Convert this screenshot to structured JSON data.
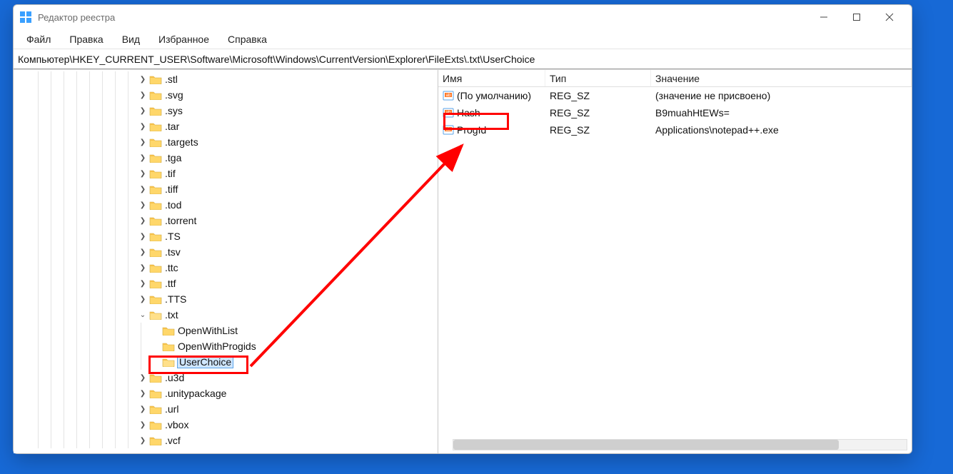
{
  "window": {
    "title": "Редактор реестра"
  },
  "menu": {
    "file": "Файл",
    "edit": "Правка",
    "view": "Вид",
    "favorites": "Избранное",
    "help": "Справка"
  },
  "addressbar": "Компьютер\\HKEY_CURRENT_USER\\Software\\Microsoft\\Windows\\CurrentVersion\\Explorer\\FileExts\\.txt\\UserChoice",
  "tree": [
    {
      "label": ".stl",
      "expander": ">",
      "depth": 8
    },
    {
      "label": ".svg",
      "expander": ">",
      "depth": 8
    },
    {
      "label": ".sys",
      "expander": ">",
      "depth": 8
    },
    {
      "label": ".tar",
      "expander": ">",
      "depth": 8
    },
    {
      "label": ".targets",
      "expander": ">",
      "depth": 8
    },
    {
      "label": ".tga",
      "expander": ">",
      "depth": 8
    },
    {
      "label": ".tif",
      "expander": ">",
      "depth": 8
    },
    {
      "label": ".tiff",
      "expander": ">",
      "depth": 8
    },
    {
      "label": ".tod",
      "expander": ">",
      "depth": 8
    },
    {
      "label": ".torrent",
      "expander": ">",
      "depth": 8
    },
    {
      "label": ".TS",
      "expander": ">",
      "depth": 8
    },
    {
      "label": ".tsv",
      "expander": ">",
      "depth": 8
    },
    {
      "label": ".ttc",
      "expander": ">",
      "depth": 8
    },
    {
      "label": ".ttf",
      "expander": ">",
      "depth": 8
    },
    {
      "label": ".TTS",
      "expander": ">",
      "depth": 8
    },
    {
      "label": ".txt",
      "expander": "v",
      "depth": 8,
      "expanded": true
    },
    {
      "label": "OpenWithList",
      "expander": "",
      "depth": 9
    },
    {
      "label": "OpenWithProgids",
      "expander": "",
      "depth": 9
    },
    {
      "label": "UserChoice",
      "expander": "",
      "depth": 9,
      "selected": true,
      "highlight": true
    },
    {
      "label": ".u3d",
      "expander": ">",
      "depth": 8
    },
    {
      "label": ".unitypackage",
      "expander": ">",
      "depth": 8
    },
    {
      "label": ".url",
      "expander": ">",
      "depth": 8
    },
    {
      "label": ".vbox",
      "expander": ">",
      "depth": 8
    },
    {
      "label": ".vcf",
      "expander": ">",
      "depth": 8
    }
  ],
  "list": {
    "columns": {
      "name": "Имя",
      "type": "Тип",
      "value": "Значение"
    },
    "rows": [
      {
        "name": "(По умолчанию)",
        "type": "REG_SZ",
        "value": "(значение не присвоено)",
        "highlight": false
      },
      {
        "name": "Hash",
        "type": "REG_SZ",
        "value": "B9muahHtEWs=",
        "highlight": false
      },
      {
        "name": "ProgId",
        "type": "REG_SZ",
        "value": "Applications\\notepad++.exe",
        "highlight": true
      }
    ]
  }
}
